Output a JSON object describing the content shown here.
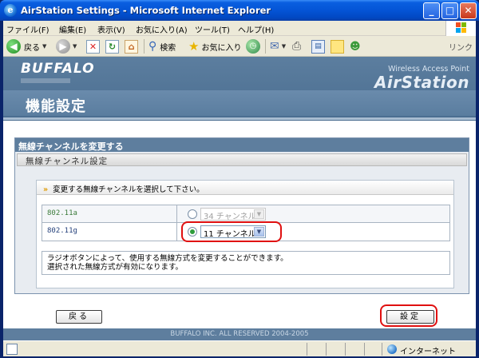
{
  "window": {
    "title": "AirStation Settings - Microsoft Internet Explorer",
    "controls": [
      "_",
      "□",
      "✕"
    ]
  },
  "menu": [
    "ファイル(F)",
    "編集(E)",
    "表示(V)",
    "お気に入り(A)",
    "ツール(T)",
    "ヘルプ(H)"
  ],
  "toolbar": {
    "back_label": "戻る",
    "search_label": "検索",
    "favorites_label": "お気に入り",
    "links_label": "リンク"
  },
  "header": {
    "brand": "BUFFALO",
    "wap": "Wireless Access Point",
    "product": "AirStation",
    "page_title": "機能設定"
  },
  "panel": {
    "heading": "無線チャンネルを変更する",
    "subheading": "無線チャンネル設定",
    "instruction": "変更する無線チャンネルを選択して下さい。",
    "rows": [
      {
        "label": "802.11a",
        "selected": false,
        "value": "34 チャンネル",
        "enabled": false
      },
      {
        "label": "802.11g",
        "selected": true,
        "value": "11 チャンネル",
        "enabled": true
      }
    ],
    "note_line1": "ラジオボタンによって、使用する無線方式を変更することができます。",
    "note_line2": "選択された無線方式が有効になります。"
  },
  "buttons": {
    "back": "戻る",
    "apply": "設定"
  },
  "footer": "BUFFALO INC. ALL RESERVED 2004-2005",
  "status": {
    "zone": "インターネット"
  },
  "colors": {
    "header": "#5C7E9F",
    "panel_head": "#5E7E9E",
    "highlight": "#E01010",
    "radio_on": "#2E9C3A"
  }
}
